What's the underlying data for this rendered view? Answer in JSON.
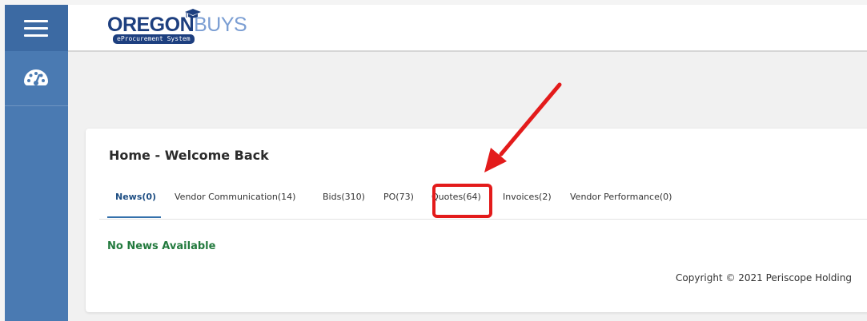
{
  "app": {
    "logo_primary": "OREGON",
    "logo_secondary": "BUYS",
    "logo_tagline": "eProcurement System"
  },
  "sidebar": {
    "menu_icon": "hamburger-menu-icon",
    "items": [
      {
        "icon": "dashboard-speedometer-icon"
      }
    ]
  },
  "home": {
    "title": "Home - Welcome Back",
    "tabs": [
      {
        "label": "News(0)",
        "active": true
      },
      {
        "label": "Vendor Communication(14)",
        "active": false
      },
      {
        "label": "Bids(310)",
        "active": false
      },
      {
        "label": "PO(73)",
        "active": false
      },
      {
        "label": "Quotes(64)",
        "active": false
      },
      {
        "label": "Invoices(2)",
        "active": false
      },
      {
        "label": "Vendor Performance(0)",
        "active": false
      }
    ],
    "news_empty_text": "No News Available",
    "copyright": "Copyright © 2021 Periscope Holding"
  },
  "annotation": {
    "highlighted_tab": "Quotes(64)",
    "color": "#e31b1b"
  },
  "colors": {
    "sidebar": "#4a7ab2",
    "sidebar_top": "#3c6aa3",
    "active_tab": "#1f4f84",
    "news_empty": "#237a3e",
    "brand_dark": "#1d3f7f",
    "brand_light": "#7b9ed3"
  }
}
